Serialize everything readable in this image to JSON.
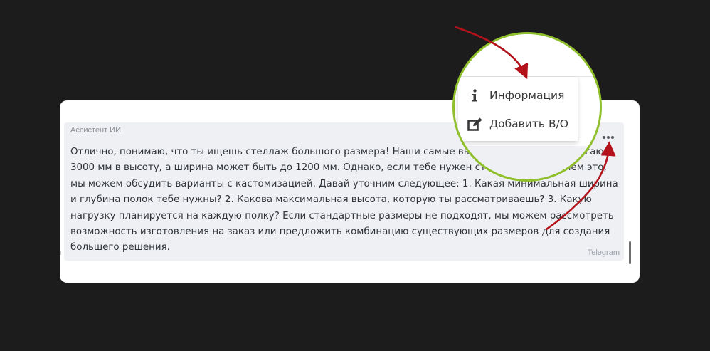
{
  "message": {
    "sender": "Ассистент ИИ",
    "text": "Отлично, понимаю, что ты ищешь стеллаж большого размера! Наши самые высокие стеллажи достигают 3000 мм в высоту, а ширина может быть до 1200 мм. Однако, если тебе нужен стеллаж больше, чем это, мы можем обсудить варианты с кастомизацией. Давай уточним следующее: 1. Какая минимальная ширина и глубина полок тебе нужны? 2. Какова максимальная высота, которую ты рассматриваешь? 3. Какую нагрузку планируется на каждую полку? Если стандартные размеры не подходят, мы можем рассмотреть возможность изготовления на заказ или предложить комбинацию существующих размеров для создания большего решения.",
    "source": "Telegram"
  },
  "menu": {
    "items": [
      {
        "label": "Информация",
        "icon": "info-icon"
      },
      {
        "label": "Добавить В/О",
        "icon": "edit-icon"
      }
    ]
  },
  "colors": {
    "background": "#1c1c1c",
    "card": "#ffffff",
    "bubble": "#eff0f4",
    "highlight_ring": "#8fbf2a",
    "arrow": "#b3121b"
  }
}
